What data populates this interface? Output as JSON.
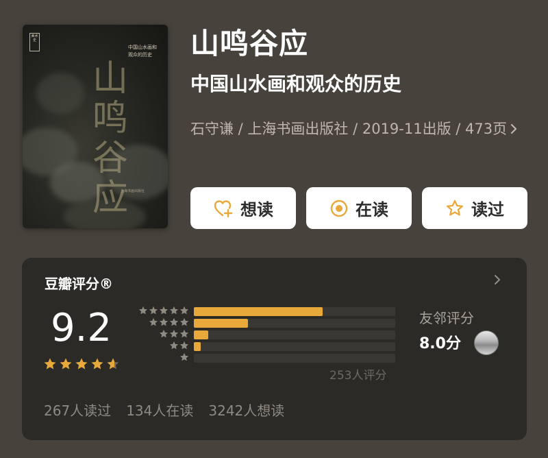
{
  "book": {
    "cover": {
      "big_title": "山鸣谷应",
      "sub_title": "中国山水画和观众的历史",
      "stamp": "美术史",
      "publisher": "上海书画出版社"
    },
    "title": "山鸣谷应",
    "subtitle": "中国山水画和观众的历史",
    "meta": "石守谦 / 上海书画出版社 / 2019-11出版 / 473页",
    "meta_chevron_icon": "chevron-right-icon"
  },
  "actions": [
    {
      "label": "想读",
      "icon": "heart-plus-icon"
    },
    {
      "label": "在读",
      "icon": "reading-circle-icon"
    },
    {
      "label": "读过",
      "icon": "star-outline-icon"
    }
  ],
  "rating": {
    "title": "豆瓣评分®",
    "score": "9.2",
    "stars": 4.6,
    "distribution_fraction": [
      0.64,
      0.27,
      0.07,
      0.035,
      0.0
    ],
    "distribution_stars": [
      5,
      4,
      3,
      2,
      1
    ],
    "count_text": "253人评分",
    "friends_label": "友邻评分",
    "friends_score": "8.0分",
    "colors": {
      "star": "#e8a93a",
      "bar": "#e8a93a",
      "track": "#3a3835",
      "card": "#2c2a27"
    }
  },
  "stats": [
    "267人读过",
    "134人在读",
    "3242人想读"
  ]
}
